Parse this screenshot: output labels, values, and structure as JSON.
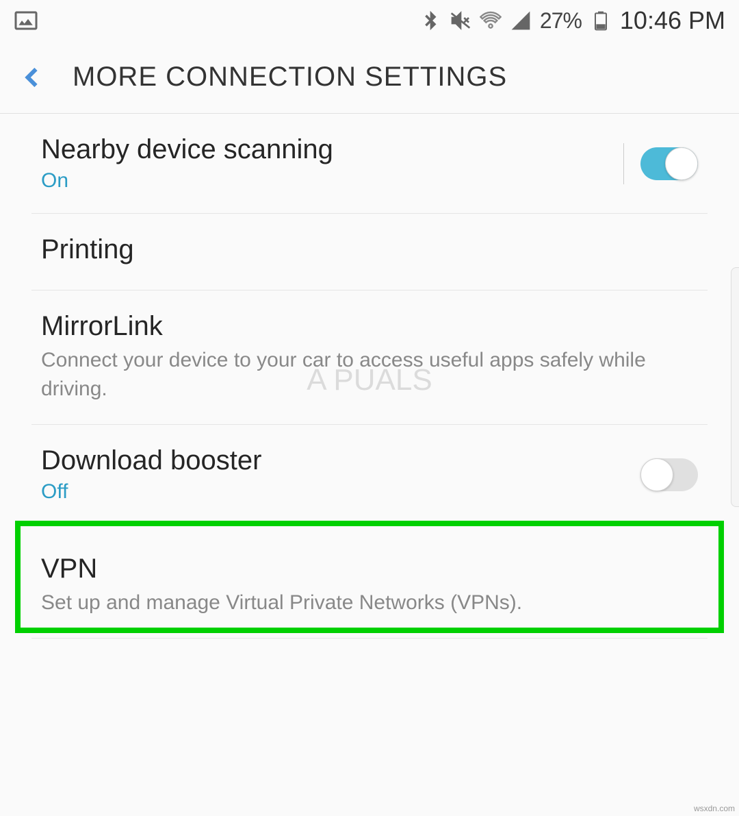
{
  "statusBar": {
    "batteryText": "27%",
    "timeText": "10:46 PM"
  },
  "appBar": {
    "title": "MORE CONNECTION SETTINGS"
  },
  "settings": {
    "nearbyScanning": {
      "title": "Nearby device scanning",
      "status": "On"
    },
    "printing": {
      "title": "Printing"
    },
    "mirrorLink": {
      "title": "MirrorLink",
      "desc": "Connect your device to your car to access useful apps safely while driving."
    },
    "downloadBooster": {
      "title": "Download booster",
      "status": "Off"
    },
    "vpn": {
      "title": "VPN",
      "desc": "Set up and manage Virtual Private Networks (VPNs)."
    }
  },
  "watermark": "A   PUALS",
  "source": "wsxdn.com"
}
